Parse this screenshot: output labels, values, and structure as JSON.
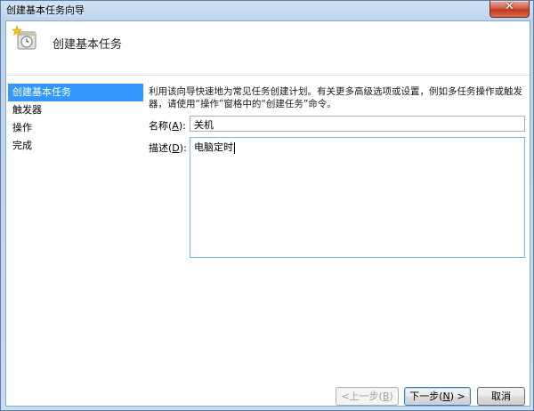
{
  "window": {
    "title": "创建基本任务向导",
    "close_glyph": "✕"
  },
  "header": {
    "title": "创建基本任务",
    "icon": "task-clock-icon"
  },
  "nav": {
    "items": [
      {
        "label": "创建基本任务",
        "active": true
      },
      {
        "label": "触发器",
        "active": false
      },
      {
        "label": "操作",
        "active": false
      },
      {
        "label": "完成",
        "active": false
      }
    ]
  },
  "main": {
    "description": "利用该向导快速地为常见任务创建计划。有关更多高级选项或设置，例如多任务操作或触发器，请使用“操作”窗格中的“创建任务”命令。",
    "name_label_prefix": "名称(",
    "name_label_key": "A",
    "name_label_suffix": "):",
    "name_value": "关机",
    "desc_label_prefix": "描述(",
    "desc_label_key": "D",
    "desc_label_suffix": "):",
    "desc_value": "电脑定时"
  },
  "footer": {
    "back_prefix": "<上一步(",
    "back_key": "B",
    "back_suffix": ")",
    "next_prefix": "下一步(",
    "next_key": "N",
    "next_suffix": ") >",
    "cancel_label": "取消"
  },
  "colors": {
    "selection": "#3399ff",
    "title_bar": "#bcd3ec",
    "close_button": "#c2391c"
  }
}
